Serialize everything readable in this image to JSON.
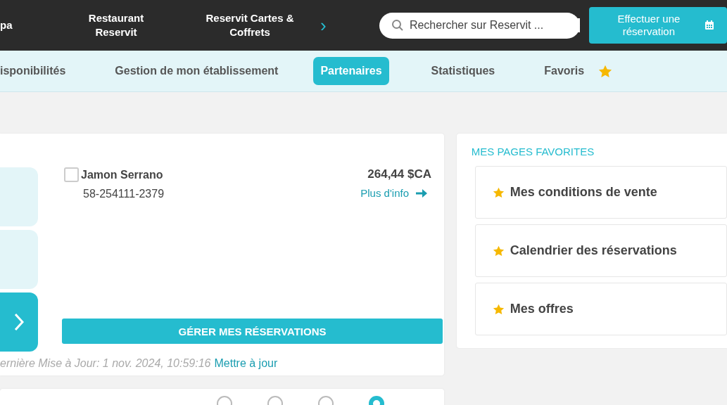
{
  "top_nav": {
    "items": [
      {
        "label": "pa"
      },
      {
        "label": "Restaurant Reservit"
      },
      {
        "label": "Reservit Cartes & Coffrets"
      }
    ],
    "more": "›",
    "search": {
      "placeholder": "Rechercher sur Reservit ..."
    },
    "reserve_button": "Effectuer une réservation"
  },
  "tabs": [
    {
      "label": "isponibilités",
      "selected": false
    },
    {
      "label": "Gestion de mon établissement",
      "selected": false
    },
    {
      "label": "Partenaires",
      "selected": true
    },
    {
      "label": "Statistiques",
      "selected": false
    },
    {
      "label": "Favoris",
      "selected": false,
      "star": true
    }
  ],
  "reservations": {
    "tiles": [
      {
        "kind": "plain"
      },
      {
        "kind": "plain"
      },
      {
        "kind": "next"
      }
    ],
    "items": [
      {
        "name": "Jamon Serrano",
        "code": "58-254111-2379",
        "amount": "264,44 $CA",
        "link": "Plus d'info",
        "checked": false
      }
    ],
    "manage_button": "GÉRER MES RÉSERVATIONS",
    "updated": "ernière Mise à Jour: 1 nov. 2024, 10:59:16",
    "refresh_link": "Mettre à jour"
  },
  "favorites": {
    "title": "MES PAGES FAVORITES",
    "items": [
      {
        "label": "Mes conditions de vente"
      },
      {
        "label": "Calendrier des réservations"
      },
      {
        "label": "Mes offres"
      }
    ]
  },
  "period": {
    "options": [
      {
        "selected": false
      },
      {
        "selected": false
      },
      {
        "selected": false
      },
      {
        "selected": true
      }
    ]
  }
}
